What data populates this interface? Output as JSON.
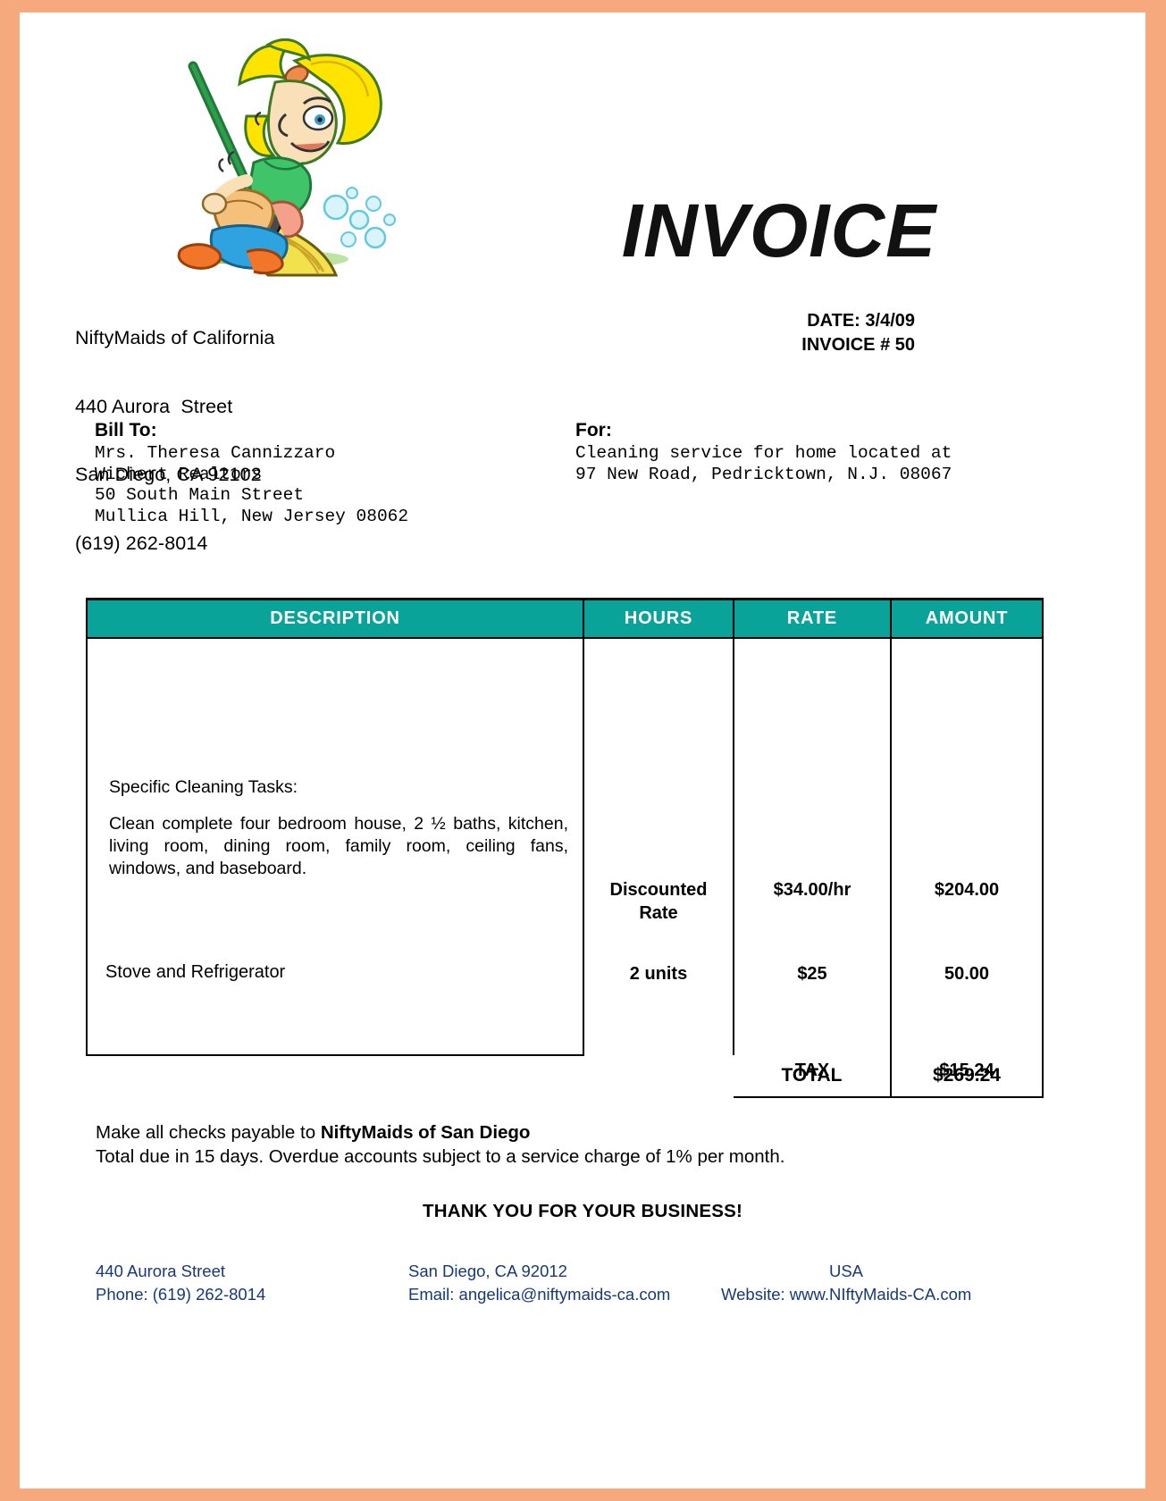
{
  "document": {
    "type": "invoice",
    "title": "INVOICE",
    "border_color": "#f5a97c",
    "accent_color": "#09A39A",
    "footer_color": "#16397a"
  },
  "logo": {
    "name": "maid-sweeping-logo",
    "alt": "Cartoon blonde maid sweeping with a broom"
  },
  "company": {
    "name": "NiftyMaids of California",
    "street": "440 Aurora  Street",
    "city_state_zip": "San Diego, CA 92102",
    "phone": "(619) 262-8014"
  },
  "meta": {
    "date_label": "DATE:",
    "date_value": "3/4/09",
    "invoice_label": "INVOICE #",
    "invoice_value": "50",
    "date_line": "DATE:  3/4/09",
    "invoice_line": "INVOICE # 50"
  },
  "bill_to": {
    "label": "Bill To:",
    "lines": [
      "Mrs. Theresa Cannizzaro",
      "Wichert Realtors",
      "50 South Main Street",
      "Mullica Hill, New Jersey 08062"
    ],
    "block": "Mrs. Theresa Cannizzaro\nWichert Realtors\n50 South Main Street\nMullica Hill, New Jersey 08062"
  },
  "for": {
    "label": "For:",
    "lines": [
      "Cleaning service for home located at",
      "97 New Road, Pedricktown, N.J. 08067"
    ],
    "block": "Cleaning service for home located at\n97 New Road, Pedricktown, N.J. 08067"
  },
  "table": {
    "headers": [
      "DESCRIPTION",
      "HOURS",
      "RATE",
      "AMOUNT"
    ],
    "description": {
      "tasks_label": "Specific Cleaning Tasks:",
      "tasks_body": "Clean complete four bedroom house, 2 ½ baths, kitchen, living room, dining room, family room, ceiling fans, windows, and baseboard.",
      "second_item": "Stove and Refrigerator"
    },
    "rows": [
      {
        "hours": "Discounted Rate",
        "hours_line1": "Discounted",
        "hours_line2": "Rate",
        "rate": "$34.00/hr",
        "amount": "$204.00"
      },
      {
        "hours": "2 units",
        "rate": "$25",
        "amount": "50.00"
      }
    ],
    "tax_label": "TAX",
    "tax_value": "$15.24",
    "total_label": "TOTAL",
    "total_value": "$269.24"
  },
  "notes": {
    "payable_prefix": "Make all checks payable to ",
    "payable_name": "NiftyMaids of San Diego",
    "terms": "Total due in 15 days. Overdue accounts subject to a service charge of 1% per month.",
    "thanks": "THANK YOU FOR YOUR BUSINESS!"
  },
  "footer": {
    "col1_line1": "440 Aurora Street",
    "col1_line2": "Phone: (619) 262-8014",
    "col2_line1": "San Diego, CA 92012",
    "col2_line2": "Email: angelica@niftymaids-ca.com",
    "col3_line1": "USA",
    "col3_line2": "Website:  www.NIftyMaids-CA.com"
  }
}
